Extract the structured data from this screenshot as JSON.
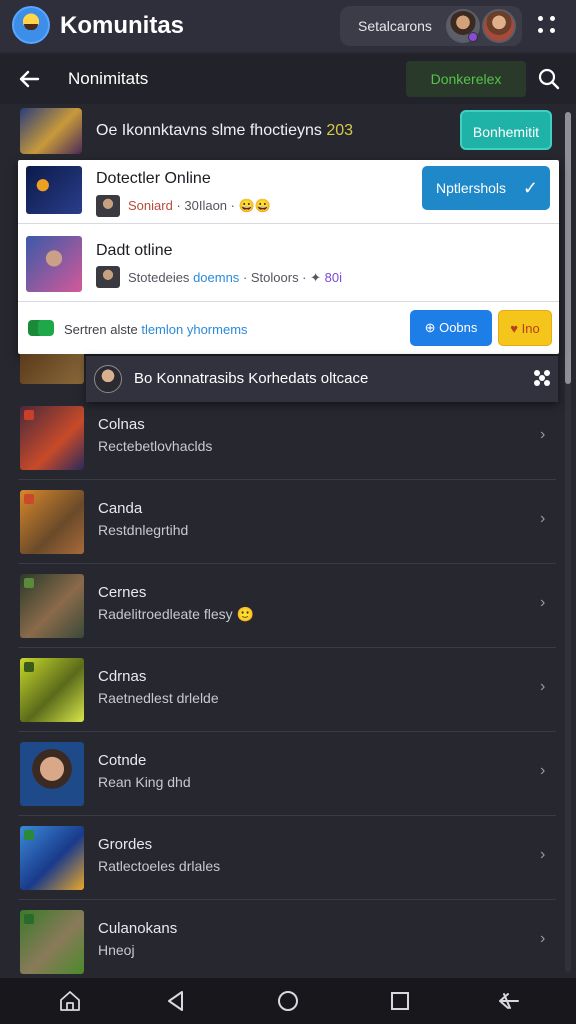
{
  "app": {
    "title": "Komunitas",
    "account_name": "Setalcarons"
  },
  "toolbar": {
    "title": "Nonimitats",
    "action_label": "Donkerelex"
  },
  "notification": {
    "text": "Oe Ikonnktavns slme fhoctieyns",
    "count": "203",
    "button_label": "Bonhemitit"
  },
  "popup": {
    "items": [
      {
        "name": "Dotectler Online",
        "sub_red": "Soniard",
        "sub_rest": "· 30Ilaon ·",
        "button_label": "Nptlershols"
      },
      {
        "name": "Dadt otline",
        "sub_text": "Stotedeies",
        "sub_link": "doemns",
        "sub_rest": "· Stoloors ·",
        "sub_count": "80i"
      }
    ],
    "footer_text": "Sertren alste",
    "footer_link": "tlemlon yhormems",
    "open_label": "Oobns",
    "fav_label": "Ino"
  },
  "banner": {
    "text": "Bo Konnatrasibs Korhedats oltcace"
  },
  "list": [
    {
      "title": "Colnas",
      "subtitle": "Rectebetlovhaclds",
      "accent": "#c8402a"
    },
    {
      "title": "Canda",
      "subtitle": "Restdnlegrtihd",
      "accent": "#d8882a"
    },
    {
      "title": "Cernes",
      "subtitle": "Radelitroedleate flesy",
      "accent": "#5a6a3a"
    },
    {
      "title": "Cdrnas",
      "subtitle": "Raetnedlest drlelde",
      "accent": "#c8d82a"
    },
    {
      "title": "Cotnde",
      "subtitle": "Rean King dhd",
      "accent": "#2a5aa8"
    },
    {
      "title": "Grordes",
      "subtitle": "Ratlectoeles drlales",
      "accent": "#2a68c8"
    },
    {
      "title": "Culanokans",
      "subtitle": "Hneoj",
      "accent": "#3a7a2a"
    }
  ],
  "icons": {
    "back": "arrow-left-icon",
    "search": "search-icon",
    "menu": "grid-menu-icon",
    "chevron": "chevron-right-icon",
    "nav_home": "home-icon",
    "nav_back": "triangle-back-icon",
    "nav_circle": "circle-home-icon",
    "nav_square": "square-recents-icon",
    "nav_extra": "swipe-back-icon"
  },
  "colors": {
    "accent_teal": "#1fb3a8",
    "primary_blue": "#1e88c8",
    "action_green": "#55c24a",
    "fav_yellow": "#f4c51a"
  }
}
